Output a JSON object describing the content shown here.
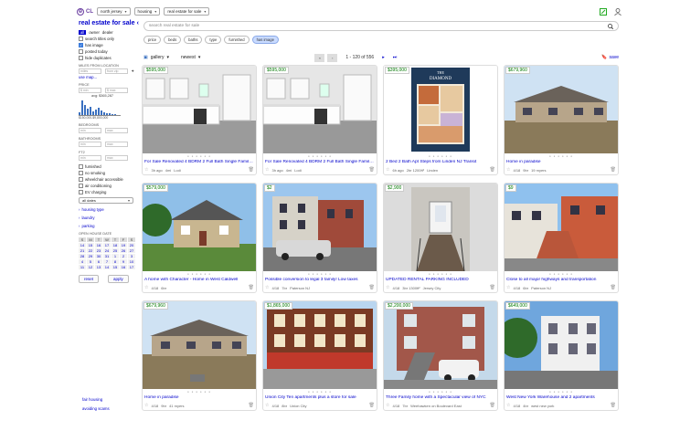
{
  "topbar": {
    "logo": "CL",
    "region": "north jersey",
    "category_group": "housing",
    "category": "real estate for sale"
  },
  "sidebar": {
    "title": "real estate for sale",
    "tabs": [
      "all",
      "owner",
      "dealer"
    ],
    "checks": [
      {
        "label": "search titles only",
        "on": false
      },
      {
        "label": "has image",
        "on": true
      },
      {
        "label": "posted today",
        "on": false
      },
      {
        "label": "hide duplicates",
        "on": false
      }
    ],
    "miles_label": "MILES FROM LOCATION",
    "miles_ph": "miles",
    "zip_ph": "from zip",
    "use_map": "use map...",
    "price_label": "PRICE",
    "price_min": "$ min",
    "price_max": "$ max",
    "avg": "avg: $365,287",
    "hist_range": "$150,000-$9,800,000",
    "bedrooms_label": "BEDROOMS",
    "bathrooms_label": "BATHROOMS",
    "ft2_label": "FT2",
    "min": "min",
    "max": "max",
    "amenities": [
      {
        "label": "furnished"
      },
      {
        "label": "no smoking"
      },
      {
        "label": "wheelchair accessible"
      },
      {
        "label": "air conditioning"
      },
      {
        "label": "EV charging"
      }
    ],
    "dates": "all dates",
    "disclosures": [
      "housing type",
      "laundry",
      "parking"
    ],
    "open_house_label": "OPEN HOUSE DATE",
    "cal_head": [
      "S",
      "M",
      "T",
      "W",
      "T",
      "F",
      "S"
    ],
    "cal_days": [
      "14",
      "15",
      "16",
      "17",
      "18",
      "19",
      "20",
      "21",
      "22",
      "23",
      "24",
      "25",
      "26",
      "27",
      "28",
      "29",
      "30",
      "31",
      "1",
      "2",
      "3",
      "4",
      "5",
      "6",
      "7",
      "8",
      "9",
      "10",
      "11",
      "12",
      "13",
      "14",
      "15",
      "16",
      "17"
    ],
    "reset": "reset",
    "apply": "apply",
    "footer": [
      "fair housing",
      "avoiding scams"
    ]
  },
  "search": {
    "placeholder": "search real estate for sale"
  },
  "chips": [
    "price",
    "beds",
    "baths",
    "type",
    "furnished",
    "has image"
  ],
  "toolbar": {
    "view": "gallery",
    "sort": "newest",
    "pager": "1 - 120 of 556",
    "save": "save"
  },
  "listings": [
    {
      "price": "$595,000",
      "title": "For Sale Renovated 4 BDRM 2 Full Bath Single Family Home",
      "age": "3h ago",
      "dist": "4mi",
      "loc": "Lodi"
    },
    {
      "price": "$595,000",
      "title": "For Sale Renovated 4 BDRM 2 Full Bath Single Family Home",
      "age": "3h ago",
      "dist": "4mi",
      "loc": "Lodi"
    },
    {
      "price": "$395,000",
      "title": "2 Bed 2 Bath Apt Steps from Linden NJ Transit",
      "age": "6h ago",
      "dist": "2br 1200ft²",
      "loc": "Linden"
    },
    {
      "price": "$679,960",
      "title": "Home in paradise",
      "age": "4/18",
      "dist": "9br",
      "loc": "19 myers"
    },
    {
      "price": "$579,000",
      "title": "A home with Character - Home in West Caldwell",
      "age": "4/18",
      "dist": "6br",
      "loc": ""
    },
    {
      "price": "$2",
      "title": "Possible conversion to legal 3 family! Low taxes",
      "age": "4/18",
      "dist": "7br",
      "loc": "Paterson NJ"
    },
    {
      "price": "$2,900",
      "title": "UPDATED RENTAL PARKING INCLUDED",
      "age": "4/18",
      "dist": "3br 1300ft²",
      "loc": "Jersey City"
    },
    {
      "price": "$9",
      "title": "Close to all major highways and transportation",
      "age": "4/18",
      "dist": "6br",
      "loc": "Paterson NJ"
    },
    {
      "price": "$679,960",
      "title": "Home in paradise",
      "age": "4/18",
      "dist": "9br",
      "loc": "41 myers"
    },
    {
      "price": "$1,865,000",
      "title": "Union City Ten apartments plus a store for sale",
      "age": "4/18",
      "dist": "8br",
      "loc": "Union City"
    },
    {
      "price": "$2,200,000",
      "title": "Three Family home with a Spectacular view of NYC",
      "age": "4/18",
      "dist": "7br",
      "loc": "Weehawken on Boulevard East"
    },
    {
      "price": "$649,000",
      "title": "West New York Warehouse and 2 apartments",
      "age": "4/18",
      "dist": "4br",
      "loc": "west new york"
    }
  ]
}
